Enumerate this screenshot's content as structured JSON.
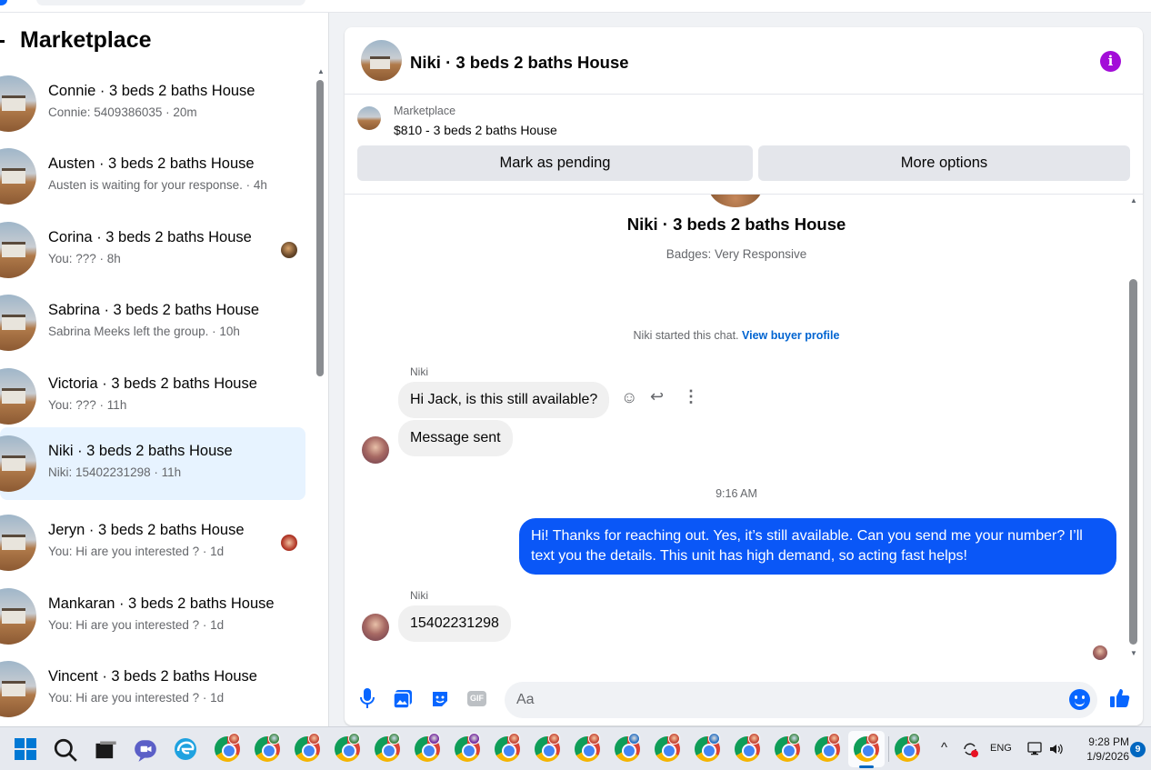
{
  "sidebar": {
    "title": "Marketplace",
    "conversations": [
      {
        "title": "Connie · 3 beds 2 baths House",
        "subtitle": "Connie: 5409386035 · 20m"
      },
      {
        "title": "Austen · 3 beds 2 baths House",
        "subtitle": "Austen is waiting for your response. · 4h"
      },
      {
        "title": "Corina · 3 beds 2 baths House",
        "subtitle": "You: ??? · 8h"
      },
      {
        "title": "Sabrina · 3 beds 2 baths House",
        "subtitle": "Sabrina Meeks left the group. · 10h"
      },
      {
        "title": "Victoria · 3 beds 2 baths House",
        "subtitle": "You: ??? · 11h"
      },
      {
        "title": "Niki · 3 beds 2 baths House",
        "subtitle": "Niki: 15402231298 · 11h"
      },
      {
        "title": "Jeryn · 3 beds 2 baths House",
        "subtitle": "You: Hi are you interested ? · 1d"
      },
      {
        "title": "Mankaran · 3 beds 2 baths House",
        "subtitle": "You: Hi are you interested ? · 1d"
      },
      {
        "title": "Vincent · 3 beds 2 baths House",
        "subtitle": "You: Hi are you interested ? · 1d"
      }
    ]
  },
  "chat": {
    "header_title": "Niki · 3 beds 2 baths House",
    "info_icon": "i",
    "marketplace": {
      "label": "Marketplace",
      "listing": "$810 - 3 beds 2 baths House",
      "pending_button": "Mark as pending",
      "more_button": "More options"
    },
    "profile_name": "Niki · 3 beds 2 baths House",
    "badges": "Badges: Very Responsive",
    "started_text": "Niki started this chat. ",
    "started_link": "View buyer profile",
    "messages": {
      "sender_1": "Niki",
      "msg_1": "Hi Jack, is this still available?",
      "msg_2": "Message sent",
      "timestamp": "9:16 AM",
      "msg_out": "Hi! Thanks for reaching out. Yes, it’s still available. Can you send me your number? I’ll text you the details. This unit has high demand, so acting fast helps!",
      "sender_2": "Niki",
      "msg_3": "15402231298"
    },
    "composer": {
      "placeholder": "Aa",
      "gif_label": "GIF"
    }
  },
  "taskbar": {
    "language": "ENG",
    "time": "9:28 PM",
    "date": "1/9/2026",
    "notification_count": "9"
  },
  "colors": {
    "accent": "#0866ff",
    "outgoing_bubble": "#0a57f7",
    "info_icon": "#a30dd8",
    "active_row": "#e7f3ff"
  },
  "icons": [
    "search-icon",
    "info-icon",
    "microphone-icon",
    "photo-icon",
    "sticker-icon",
    "gif-icon",
    "emoji-icon",
    "like-icon",
    "react-icon",
    "reply-icon",
    "more-icon"
  ]
}
